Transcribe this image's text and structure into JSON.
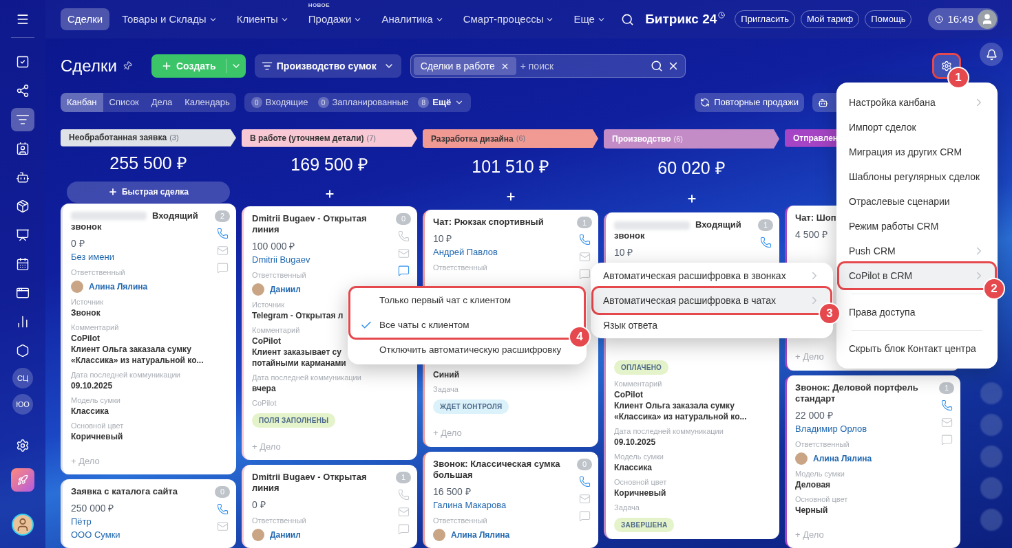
{
  "sidebar": {
    "items": [
      {
        "kind": "tasks",
        "selected": false
      },
      {
        "kind": "network",
        "selected": false
      },
      {
        "kind": "funnel",
        "selected": true
      },
      {
        "kind": "contacts",
        "selected": false
      },
      {
        "kind": "robot",
        "selected": false
      },
      {
        "kind": "box",
        "selected": false
      },
      {
        "kind": "board",
        "selected": false
      },
      {
        "kind": "calendar",
        "selected": false
      },
      {
        "kind": "window",
        "selected": false
      },
      {
        "kind": "chart",
        "selected": false
      },
      {
        "kind": "hexagon",
        "selected": false
      },
      {
        "kind": "initials",
        "text": "СЦ",
        "selected": false
      },
      {
        "kind": "initials",
        "text": "ЮО",
        "selected": false
      },
      {
        "kind": "settings",
        "selected": false
      },
      {
        "kind": "rocket",
        "selected": false
      },
      {
        "kind": "avatar",
        "selected": false
      }
    ]
  },
  "top_nav": {
    "tabs": [
      {
        "label": "Сделки",
        "selected": true,
        "dropdown": false
      },
      {
        "label": "Товары и Склады",
        "selected": false,
        "dropdown": true
      },
      {
        "label": "Клиенты",
        "selected": false,
        "dropdown": true
      },
      {
        "label": "Продажи",
        "selected": false,
        "dropdown": true,
        "badge": "НОВОЕ"
      },
      {
        "label": "Аналитика",
        "selected": false,
        "dropdown": true
      },
      {
        "label": "Смарт-процессы",
        "selected": false,
        "dropdown": true
      },
      {
        "label": "Еще",
        "selected": false,
        "dropdown": true
      }
    ],
    "logo": "Битрикс 24",
    "buttons": [
      "Пригласить",
      "Мой тариф",
      "Помощь"
    ],
    "time": "16:49"
  },
  "toolbar": {
    "title": "Сделки",
    "create": "Создать",
    "pipeline": "Производство сумок",
    "filter_chip": "Сделки в работе",
    "search_placeholder": "+ поиск",
    "settings_annotation": "1"
  },
  "views": [
    {
      "label": "Канбан",
      "selected": true
    },
    {
      "label": "Список",
      "selected": false
    },
    {
      "label": "Дела",
      "selected": false
    },
    {
      "label": "Календарь",
      "selected": false
    }
  ],
  "counters": [
    {
      "count": "0",
      "label": "Входящие",
      "dropdown": false
    },
    {
      "count": "0",
      "label": "Запланированные",
      "dropdown": false
    },
    {
      "count": "8",
      "label": "Ещё",
      "dropdown": true
    }
  ],
  "actions": [
    {
      "kind": "repeat",
      "label": "Повторные продажи"
    },
    {
      "kind": "robot"
    }
  ],
  "columns": [
    {
      "title": "Необработанная заявка",
      "count": "(3)",
      "color": "#dfe2e6",
      "light_text": false,
      "total": "255 500 ₽",
      "quick_add": "Быстрая сделка",
      "add_button": false,
      "cards": [
        {
          "title": "Входящий звонок",
          "redacted": true,
          "counter": "2",
          "amount": "0 ₽",
          "channels": [
            {
              "kind": "phone",
              "active": true
            },
            {
              "kind": "mail",
              "active": false
            },
            {
              "kind": "chat",
              "active": false
            }
          ],
          "rows": [
            {
              "kind": "link",
              "text": "Без имени"
            },
            {
              "kind": "label",
              "text": "Ответственный"
            },
            {
              "kind": "person",
              "text": "Алина Лялина"
            },
            {
              "kind": "label",
              "text": "Источник"
            },
            {
              "kind": "value",
              "text": "Звонок"
            },
            {
              "kind": "label",
              "text": "Комментарий"
            },
            {
              "kind": "value",
              "text": "CoPilot"
            },
            {
              "kind": "value",
              "text": "Клиент Ольга заказала сумку «Классика» из натуральной ко..."
            },
            {
              "kind": "label",
              "text": "Дата последней коммуникации"
            },
            {
              "kind": "value",
              "text": "09.10.2025"
            },
            {
              "kind": "label",
              "text": "Модель сумки"
            },
            {
              "kind": "value",
              "text": "Классика"
            },
            {
              "kind": "label",
              "text": "Основной цвет"
            },
            {
              "kind": "value",
              "text": "Коричневый"
            }
          ],
          "footer": "+ Дело"
        },
        {
          "title": "Заявка с каталога сайта",
          "redacted": false,
          "counter": "0",
          "amount": "250 000 ₽",
          "channels": [
            {
              "kind": "phone",
              "active": true
            },
            {
              "kind": "mail",
              "active": false
            }
          ],
          "rows": [
            {
              "kind": "link",
              "text": "Пётр"
            },
            {
              "kind": "link",
              "text": "ООО Сумки"
            }
          ]
        }
      ]
    },
    {
      "title": "В работе (уточняем детали)",
      "count": "(7)",
      "color": "#f8c8d5",
      "light_text": false,
      "total": "169 500 ₽",
      "add_button": true,
      "cards": [
        {
          "title": "Dmitrii Bugaev - Открытая линия",
          "redacted": false,
          "counter": "0",
          "amount": "100 000 ₽",
          "channels": [
            {
              "kind": "phone",
              "active": false
            },
            {
              "kind": "mail",
              "active": false
            },
            {
              "kind": "chat",
              "active": true
            }
          ],
          "rows": [
            {
              "kind": "link",
              "text": "Dmitrii Bugaev"
            },
            {
              "kind": "label",
              "text": "Ответственный"
            },
            {
              "kind": "person",
              "text": "Даниил"
            },
            {
              "kind": "label",
              "text": "Источник"
            },
            {
              "kind": "value",
              "text": "Telegram - Открытая л"
            },
            {
              "kind": "label",
              "text": "Комментарий"
            },
            {
              "kind": "value",
              "text": "CoPilot"
            },
            {
              "kind": "value",
              "text": "Клиент заказывает су"
            },
            {
              "kind": "value",
              "text": "потайными карманами"
            },
            {
              "kind": "label",
              "text": "Дата последней коммуникации"
            },
            {
              "kind": "value",
              "text": "вчера"
            },
            {
              "kind": "label",
              "text": "CoPilot"
            },
            {
              "kind": "badge",
              "color": "#e4f3c9",
              "text": "ПОЛЯ ЗАПОЛНЕНЫ"
            }
          ],
          "footer": "+ Дело"
        },
        {
          "title": "Dmitrii Bugaev - Открытая линия",
          "redacted": false,
          "counter": "1",
          "amount": "0 ₽",
          "channels": [
            {
              "kind": "phone",
              "active": false
            },
            {
              "kind": "mail",
              "active": false
            },
            {
              "kind": "chat",
              "active": false
            }
          ],
          "rows": [
            {
              "kind": "label",
              "text": "Ответственный"
            },
            {
              "kind": "person",
              "text": "Даниил"
            }
          ]
        }
      ]
    },
    {
      "title": "Разработка дизайна",
      "count": "(6)",
      "color": "#f19a94",
      "light_text": false,
      "total": "101 510 ₽",
      "add_button": true,
      "cards": [
        {
          "title": "Чат: Рюкзак спортивный",
          "redacted": false,
          "counter": "1",
          "amount": "10 ₽",
          "channels": [
            {
              "kind": "phone",
              "active": true
            },
            {
              "kind": "mail",
              "active": false
            },
            {
              "kind": "chat",
              "active": false
            }
          ],
          "rows": [
            {
              "kind": "link",
              "text": "Андрей Павлов"
            },
            {
              "kind": "label",
              "text": "Ответственный"
            },
            {
              "kind": "gap"
            },
            {
              "kind": "value",
              "text": "Синий"
            },
            {
              "kind": "label",
              "text": "Задача"
            },
            {
              "kind": "badge",
              "color": "#dcf2fb",
              "text": "ЖДЕТ КОНТРОЛЯ"
            }
          ],
          "footer": "+ Дело"
        },
        {
          "title": "Звонок: Классическая сумка большая",
          "redacted": false,
          "counter": "0",
          "amount": "16 500 ₽",
          "channels": [
            {
              "kind": "phone",
              "active": true
            },
            {
              "kind": "mail",
              "active": false
            },
            {
              "kind": "chat",
              "active": false
            }
          ],
          "rows": [
            {
              "kind": "link",
              "text": "Галина Макарова"
            },
            {
              "kind": "label",
              "text": "Ответственный"
            },
            {
              "kind": "person",
              "text": "Алина Лялина"
            }
          ]
        }
      ]
    },
    {
      "title": "Производство",
      "count": "(6)",
      "color": "#c38cc6",
      "light_text": true,
      "total": "60 020 ₽",
      "add_button": true,
      "cards": [
        {
          "title": "Входящий звонок",
          "redacted": true,
          "counter": "1",
          "amount": "10 ₽",
          "channels": [
            {
              "kind": "phone",
              "active": true
            }
          ],
          "rows": [
            {
              "kind": "gap"
            },
            {
              "kind": "badge",
              "color": "#e4f3c9",
              "text": "ОПЛАЧЕНО"
            },
            {
              "kind": "label",
              "text": "Комментарий"
            },
            {
              "kind": "value",
              "text": "CoPilot"
            },
            {
              "kind": "value",
              "text": "Клиент Ольга заказала сумку «Классика» из натуральной ко..."
            },
            {
              "kind": "label",
              "text": "Дата последней коммуникации"
            },
            {
              "kind": "value",
              "text": "09.10.2025"
            },
            {
              "kind": "label",
              "text": "Модель сумки"
            },
            {
              "kind": "value",
              "text": "Классика"
            },
            {
              "kind": "label",
              "text": "Основной цвет"
            },
            {
              "kind": "value",
              "text": "Коричневый"
            },
            {
              "kind": "label",
              "text": "Задача"
            },
            {
              "kind": "badge",
              "color": "#e4f3c9",
              "text": "ЗАВЕРШЕНА"
            }
          ]
        }
      ]
    },
    {
      "title": "Отправлен",
      "color": "#a544c4",
      "light_text": true,
      "add_button": false,
      "cards": [
        {
          "title": "Чат: Шоп",
          "redacted": false,
          "amount": "4 500 ₽",
          "rows": [
            {
              "kind": "gap"
            }
          ],
          "footer": "+ Дело"
        },
        {
          "title": "Звонок: Деловой портфель стандарт",
          "redacted": false,
          "counter": "1",
          "amount": "22 000 ₽",
          "channels": [
            {
              "kind": "phone",
              "active": true
            },
            {
              "kind": "mail",
              "active": false
            },
            {
              "kind": "chat",
              "active": false
            }
          ],
          "rows": [
            {
              "kind": "link",
              "text": "Владимир Орлов"
            },
            {
              "kind": "label",
              "text": "Ответственный"
            },
            {
              "kind": "person",
              "text": "Алина Лялина"
            },
            {
              "kind": "label",
              "text": "Модель сумки"
            },
            {
              "kind": "value",
              "text": "Деловая"
            },
            {
              "kind": "label",
              "text": "Основной цвет"
            },
            {
              "kind": "value",
              "text": "Черный"
            }
          ],
          "footer": "+ Дело"
        }
      ]
    }
  ],
  "settings_menu": {
    "items": [
      {
        "kind": "item",
        "label": "Настройка канбана",
        "submenu": true,
        "selected": false
      },
      {
        "kind": "item",
        "label": "Импорт сделок",
        "submenu": false,
        "selected": false
      },
      {
        "kind": "item",
        "label": "Миграция из других CRM",
        "submenu": false,
        "selected": false
      },
      {
        "kind": "item",
        "label": "Шаблоны регулярных сделок",
        "submenu": false,
        "selected": false
      },
      {
        "kind": "item",
        "label": "Отраслевые сценарии",
        "submenu": false,
        "selected": false
      },
      {
        "kind": "item",
        "label": "Режим работы CRM",
        "submenu": false,
        "selected": false
      },
      {
        "kind": "item",
        "label": "Push CRM",
        "submenu": true,
        "selected": false
      },
      {
        "kind": "item",
        "label": "CoPilot в CRM",
        "submenu": true,
        "selected": true,
        "annotation": "2"
      },
      {
        "kind": "divider"
      },
      {
        "kind": "item",
        "label": "Права доступа",
        "submenu": false,
        "selected": false
      },
      {
        "kind": "divider"
      },
      {
        "kind": "item",
        "label": "Скрыть блок Контакт центра",
        "submenu": false,
        "selected": false
      }
    ]
  },
  "copilot_menu": {
    "items": [
      {
        "label": "Автоматическая расшифровка в звонках",
        "submenu": true,
        "selected": false
      },
      {
        "label": "Автоматическая расшифровка в чатах",
        "submenu": true,
        "selected": true,
        "annotation": "3"
      },
      {
        "label": "Язык ответа",
        "submenu": false,
        "selected": false
      }
    ]
  },
  "transcription_menu": {
    "groups": [
      {
        "annotation": "4",
        "items": [
          {
            "label": "Только первый чат с клиентом",
            "checked": false
          },
          {
            "label": "Все чаты с клиентом",
            "checked": true
          }
        ]
      },
      {
        "items": [
          {
            "label": "Отключить автоматическую расшифровку",
            "checked": false
          }
        ]
      }
    ]
  }
}
